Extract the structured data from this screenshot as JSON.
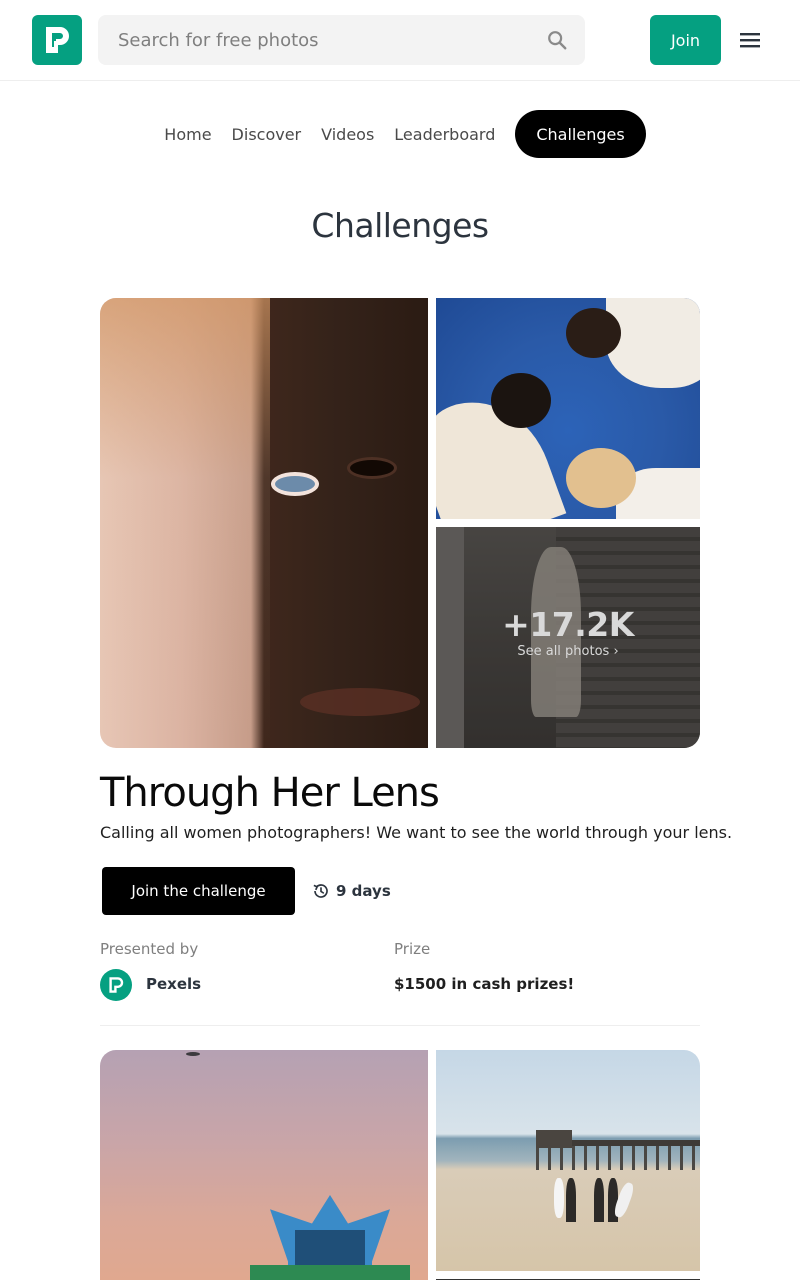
{
  "header": {
    "logo_alt": "Pexels",
    "search_placeholder": "Search for free photos",
    "join_label": "Join"
  },
  "nav": {
    "items": [
      {
        "label": "Home",
        "active": false
      },
      {
        "label": "Discover",
        "active": false
      },
      {
        "label": "Videos",
        "active": false
      },
      {
        "label": "Leaderboard",
        "active": false
      },
      {
        "label": "Challenges",
        "active": true
      }
    ]
  },
  "page_title": "Challenges",
  "challenges": [
    {
      "more_count": "+17.2K",
      "see_all": "See all photos ›",
      "title": "Through Her Lens",
      "description": "Calling all women photographers! We want to see the world through your lens.",
      "cta_label": "Join the challenge",
      "time_left": "9 days",
      "presented_by_label": "Presented by",
      "presenter": "Pexels",
      "prize_label": "Prize",
      "prize": "$1500 in cash prizes!"
    }
  ],
  "colors": {
    "brand": "#05a081",
    "text": "#2c343e",
    "muted": "#7f7f7f",
    "black": "#000000"
  }
}
